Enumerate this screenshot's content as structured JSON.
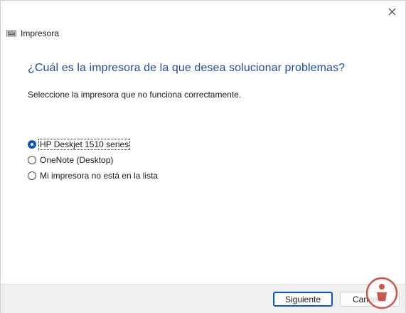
{
  "window": {
    "header_title": "Impresora",
    "question": "¿Cuál es la impresora de la que desea solucionar problemas?",
    "instruction": "Seleccione la impresora que no funciona correctamente."
  },
  "options": [
    {
      "label": "HP Deskjet 1510 series",
      "checked": true
    },
    {
      "label": "OneNote (Desktop)",
      "checked": false
    },
    {
      "label": "Mi impresora no está en la lista",
      "checked": false
    }
  ],
  "footer": {
    "next_label": "Siguiente",
    "cancel_label": "Cancelar"
  },
  "colors": {
    "accent": "#0a56c2",
    "question_text": "#1f4fa0",
    "footer_bg": "#f0f0f0",
    "watermark": "#c0392b"
  },
  "icons": {
    "close": "close-icon",
    "app": "printer-icon",
    "watermark": "logo-watermark-icon"
  }
}
